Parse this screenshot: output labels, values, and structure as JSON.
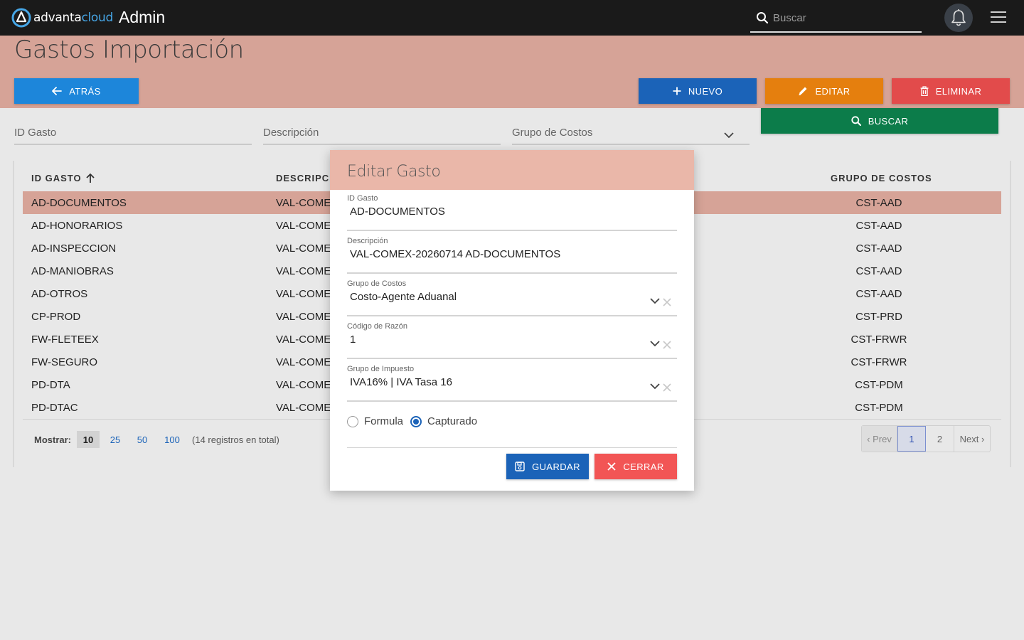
{
  "topbar": {
    "logo_part1": "advanta",
    "logo_part2": "cloud",
    "app_title": "Admin",
    "search_placeholder": "Buscar"
  },
  "page": {
    "title": "Gastos Importación",
    "back_label": "ATRÁS",
    "new_label": "NUEVO",
    "edit_label": "EDITAR",
    "delete_label": "ELIMINAR",
    "search_label": "BUSCAR"
  },
  "filters": {
    "id": "ID Gasto",
    "desc": "Descripción",
    "group": "Grupo de Costos"
  },
  "table": {
    "headers": [
      "ID GASTO",
      "DESCRIPCIÓN",
      "GRUPO DE COSTOS"
    ],
    "rows": [
      {
        "id": "AD-DOCUMENTOS",
        "desc": "VAL-COMEX",
        "group": "CST-AAD"
      },
      {
        "id": "AD-HONORARIOS",
        "desc": "VAL-COMEX",
        "group": "CST-AAD"
      },
      {
        "id": "AD-INSPECCION",
        "desc": "VAL-COMEX",
        "group": "CST-AAD"
      },
      {
        "id": "AD-MANIOBRAS",
        "desc": "VAL-COMEX",
        "group": "CST-AAD"
      },
      {
        "id": "AD-OTROS",
        "desc": "VAL-COMEX",
        "group": "CST-AAD"
      },
      {
        "id": "CP-PROD",
        "desc": "VAL-COMEX",
        "group": "CST-PRD"
      },
      {
        "id": "FW-FLETEEX",
        "desc": "VAL-COMEX",
        "group": "CST-FRWR"
      },
      {
        "id": "FW-SEGURO",
        "desc": "VAL-COMEX",
        "group": "CST-FRWR"
      },
      {
        "id": "PD-DTA",
        "desc": "VAL-COMEX",
        "group": "CST-PDM"
      },
      {
        "id": "PD-DTAC",
        "desc": "VAL-COMEX",
        "group": "CST-PDM"
      }
    ],
    "selected_index": 0
  },
  "pager": {
    "show_label": "Mostrar:",
    "sizes": [
      "10",
      "25",
      "50",
      "100"
    ],
    "current_size": "10",
    "total_text": "(14 registros en total)",
    "prev": "‹ Prev",
    "pages": [
      "1",
      "2"
    ],
    "current_page": "1",
    "next": "Next ›"
  },
  "modal": {
    "title": "Editar Gasto",
    "fields": [
      {
        "label": "ID Gasto",
        "value": "AD-DOCUMENTOS"
      },
      {
        "label": "Descripción",
        "value": "VAL-COMEX-20260714 AD-DOCUMENTOS"
      },
      {
        "label": "Grupo de Costos",
        "value": "Costo-Agente Aduanal"
      },
      {
        "label": "Código de Razón",
        "value": "1"
      },
      {
        "label": "Grupo de Impuesto",
        "value": "IVA16% | IVA Tasa 16"
      }
    ],
    "radio_formula": "Formula",
    "radio_captured": "Capturado",
    "selected_radio": "Capturado",
    "save_label": "GUARDAR",
    "close_label": "CERRAR"
  },
  "colors": {
    "band": "#d6a397",
    "primary": "#1b63b8",
    "edit": "#e57f0e",
    "delete": "#e24b4b",
    "search": "#0c7c4a",
    "modal_header": "#eab7a9"
  }
}
